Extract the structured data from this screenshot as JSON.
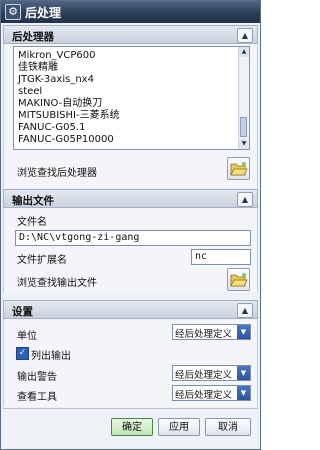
{
  "window": {
    "title": "后处理"
  },
  "postprocessor": {
    "header": "后处理器",
    "items": [
      "Mikron_VCP600",
      "佳铁精雕",
      "JTGK-3axis_nx4",
      "steel",
      "MAKINO-自动换刀",
      "MITSUBISHI-三菱系统",
      "FANUC-G05.1",
      "FANUC-G05P10000"
    ],
    "browse_label": "浏览查找后处理器"
  },
  "output": {
    "header": "输出文件",
    "filename_label": "文件名",
    "filename_value": "D:\\NC\\vtgong-zi-gang",
    "ext_label": "文件扩展名",
    "ext_value": "nc",
    "browse_label": "浏览查找输出文件"
  },
  "settings": {
    "header": "设置",
    "units_label": "单位",
    "units_value": "经后处理定义",
    "list_output_label": "列出输出",
    "list_output_checked": true,
    "warning_label": "输出警告",
    "warning_value": "经后处理定义",
    "review_label": "查看工具",
    "review_value": "经后处理定义"
  },
  "footer": {
    "ok_label": "确定",
    "apply_label": "应用",
    "cancel_label": "取消"
  },
  "colors": {
    "titlebar": "#2d3e57",
    "select_arrow": "#2c55a0",
    "ok_button": "#bfe4b5"
  }
}
